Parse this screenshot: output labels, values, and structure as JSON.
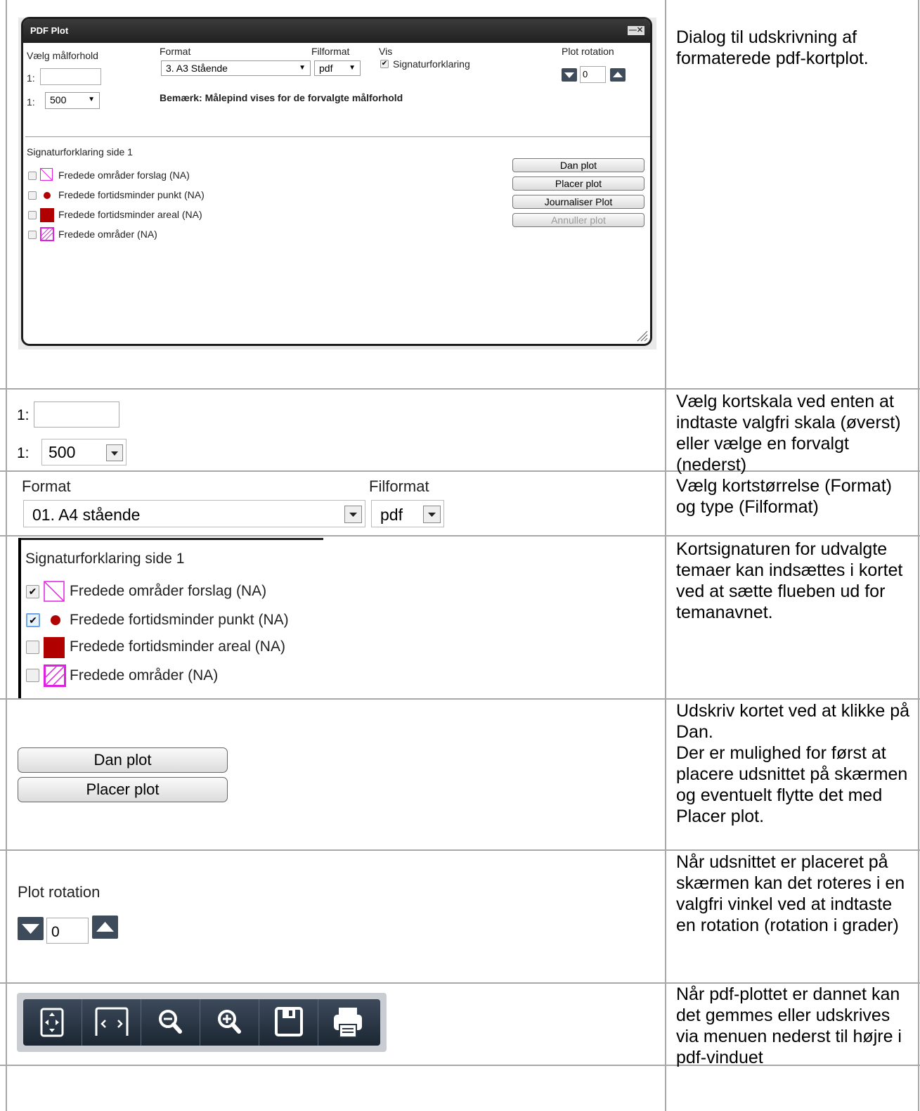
{
  "dialog": {
    "title": "PDF Plot",
    "close_label": "—✕",
    "scale_heading": "Vælg målforhold",
    "scale_prefix": "1:",
    "scale_custom_value": "",
    "scale_select_value": "500",
    "format_label": "Format",
    "format_value": "3. A3 Stående",
    "fileformat_label": "Filformat",
    "fileformat_value": "pdf",
    "vis_label": "Vis",
    "vis_checkbox_label": "Signaturforklaring",
    "rotation_label": "Plot rotation",
    "rotation_value": "0",
    "note": "Bemærk: Målepind vises for de forvalgte målforhold",
    "legend_heading": "Signaturforklaring side 1",
    "legend_items": [
      {
        "label": "Fredede områder forslag (NA)",
        "checked": false
      },
      {
        "label": "Fredede fortidsminder punkt (NA)",
        "checked": false
      },
      {
        "label": "Fredede fortidsminder areal (NA)",
        "checked": false
      },
      {
        "label": "Fredede områder (NA)",
        "checked": false
      }
    ],
    "buttons": [
      "Dan plot",
      "Placer plot",
      "Journaliser Plot",
      "Annuller plot"
    ]
  },
  "rows": [
    {
      "description": "Dialog til udskrivning af formaterede pdf-kortplot."
    },
    {
      "description": "Vælg kortskala ved enten at indtaste valgfri skala (øverst) eller vælge en forvalgt (nederst)"
    },
    {
      "description": "Vælg kortstørrelse (Format) og type (Filformat)"
    },
    {
      "description": "Kortsignaturen for udvalgte temaer kan indsættes i kortet ved at sætte flueben ud for temanavnet."
    },
    {
      "description": "Udskriv kortet ved at klikke på Dan.\nDer er mulighed for først at placere udsnittet på skærmen og eventuelt flytte det med Placer plot."
    },
    {
      "description": "Når udsnittet er placeret på skærmen kan det roteres i en valgfri vinkel ved at indtaste en rotation (rotation i grader)"
    },
    {
      "description": "Når pdf-plottet er dannet kan det gemmes eller udskrives via menuen nederst til højre i pdf-vinduet"
    }
  ],
  "scale_zoom": {
    "prefix": "1:",
    "custom_value": "",
    "select_value": "500"
  },
  "format_zoom": {
    "format_label": "Format",
    "format_value": "01. A4 stående",
    "fileformat_label": "Filformat",
    "fileformat_value": "pdf"
  },
  "legend_zoom": {
    "heading": "Signaturforklaring side 1",
    "items": [
      {
        "label": "Fredede områder forslag (NA)",
        "checked": true
      },
      {
        "label": "Fredede fortidsminder punkt (NA)",
        "checked": true
      },
      {
        "label": "Fredede fortidsminder areal (NA)",
        "checked": false
      },
      {
        "label": "Fredede områder (NA)",
        "checked": false
      }
    ]
  },
  "buttons_zoom": [
    "Dan plot",
    "Placer plot"
  ],
  "rotation_zoom": {
    "label": "Plot rotation",
    "value": "0"
  },
  "pdf_toolbar": {
    "icons": [
      "fit-page-icon",
      "fit-width-icon",
      "zoom-out-icon",
      "zoom-in-icon",
      "save-icon",
      "print-icon"
    ],
    "background": "#1c2633"
  },
  "colors": {
    "legend_red": "#b00000",
    "legend_magenta": "#e020e0",
    "toolbar_blue": "#3c4a5b"
  }
}
